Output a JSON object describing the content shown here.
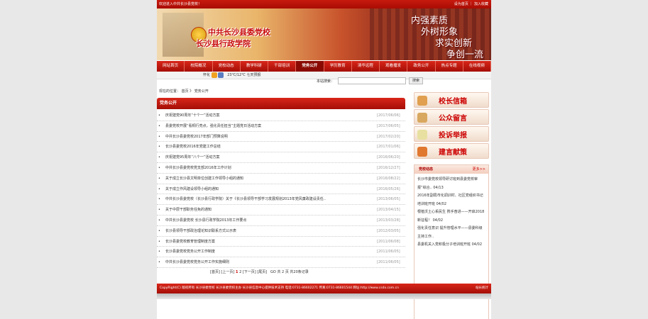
{
  "topbar": {
    "welcome": "欢迎进入中共长沙县党校！",
    "links": "设为首页 ｜ 加入收藏"
  },
  "banner": {
    "title1": "中共长沙县委党校",
    "title2": "长沙县行政学院",
    "slogans": [
      "内强素质",
      "外树形象",
      "求实创新",
      "争创一流"
    ]
  },
  "nav": [
    "网站首页",
    "校院概况",
    "党校动态",
    "教学科研",
    "干部培训",
    "党务公开",
    "学历教育",
    "清华远程",
    "观看播发",
    "政务公开",
    "热点专题",
    "在线视频"
  ],
  "nav_active": 5,
  "subbar": {
    "weather_city": "怀化",
    "weather_temp": "23℃/12℃",
    "weather_link": "七天预报"
  },
  "search": {
    "label": "本站搜索：",
    "value": "",
    "button": "搜索"
  },
  "breadcrumb": "现在的位置： 首页 》 党务公开",
  "list": {
    "title": "党务公开",
    "rows": [
      {
        "text": "庆祝建党90周年“十个一”活动方案",
        "date": "[2017/06/06]"
      },
      {
        "text": "县委党校开展“看桐行亮点，强化责任担当”主题党日活动方案",
        "date": "[2017/06/05]"
      },
      {
        "text": "中共长沙县委党校2017年部门预算说明",
        "date": "[2017/02/20]"
      },
      {
        "text": "长沙县委党校2016年党建工作总结",
        "date": "[2017/01/06]"
      },
      {
        "text": "庆祝建党95周年“八个一”活动方案",
        "date": "[2016/06/20]"
      },
      {
        "text": "中共长沙县委党校党支部2016年工作计划",
        "date": "[2016/12/27]"
      },
      {
        "text": "关于成立长沙县文明单位创建工作领导小组的通知",
        "date": "[2016/08/22]"
      },
      {
        "text": "关于成立作风建设领导小组的通知",
        "date": "[2016/05/26]"
      },
      {
        "text": "中共长沙县委党校（长沙县行政学院）关于《长沙县领导干部学习发展规划2013年党风廉政建设责任..",
        "date": "[2013/06/05]"
      },
      {
        "text": "关于中层干部职务任免的通知",
        "date": "[2013/04/15]"
      },
      {
        "text": "中共长沙县委党校 长沙县行政学院2013年工作要点",
        "date": "[2013/03/28]"
      },
      {
        "text": "长沙县领导干部政治理论知识联系方式公示表",
        "date": "[2012/03/05]"
      },
      {
        "text": "长沙县委党校教育管理制度方案",
        "date": "[2011/06/08]"
      },
      {
        "text": "长沙县委党校党务公开工作制度",
        "date": "[2011/06/05]"
      },
      {
        "text": "中共长沙县委党校党务公开工作实施细则",
        "date": "[2011/06/05]"
      }
    ]
  },
  "pager": {
    "first": "[首页]",
    "prev": "[上一页]",
    "p1": "1",
    "p2": "2",
    "next": "[下一页]",
    "last": "[尾页]",
    "goto": "GO",
    "summary": "共 2 页   共20条记录"
  },
  "side": {
    "buttons": [
      "校长信箱",
      "公众留言",
      "投诉举报",
      "建言献策"
    ],
    "news_title": "党校动态",
    "news_more": "更多>>",
    "news": [
      "长沙市委党校领导研讨班到县委党校审报“综合..     04/13",
      "2016年副局市化调训村、社区党组织书记培训班开班     04/02",
      "根植沃土心系民生 携手奋进——开启2018新征程！     04/02",
      "强化责任意识 提升管理水平——县委科级主持工作..",
      "县委机关入党积极分子培训班开班     04/02"
    ]
  },
  "footer": {
    "left": "CopyRight(C) 版权所有 长沙县委党校 长沙县委党校主办 长沙县信息中心提供技术支持 电话:0731-86602271 传真:0731-86601544 网址:http://www.csdx.com.cn",
    "right": "站长统计"
  },
  "colors": {
    "primary_red": "#c81a0e",
    "dark_red": "#a50e06"
  }
}
